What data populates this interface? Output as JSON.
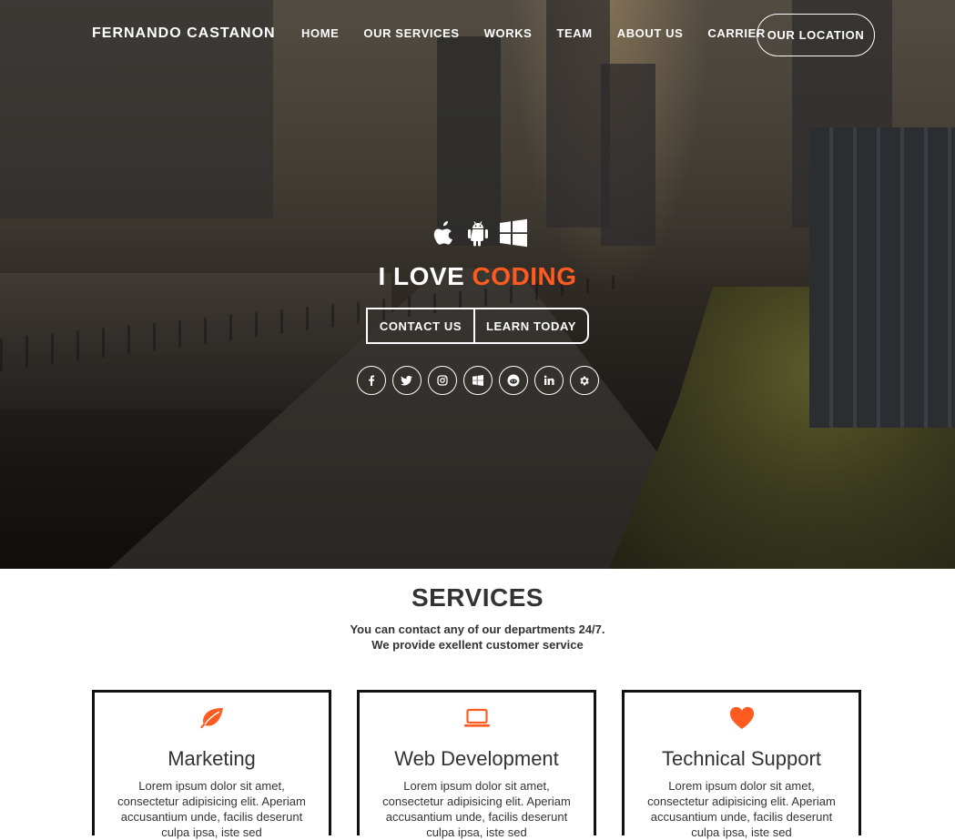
{
  "nav": {
    "brand": "FERNANDO CASTANON",
    "items": [
      "HOME",
      "OUR SERVICES",
      "WORKS",
      "TEAM",
      "ABOUT US",
      "CARRIER"
    ],
    "location_button": "OUR LOCATION"
  },
  "hero": {
    "platform_icons": [
      "apple-icon",
      "android-icon",
      "windows-icon"
    ],
    "headline_prefix": "I LOVE ",
    "headline_accent": "CODING",
    "contact_button": "CONTACT US",
    "learn_button": "LEARN TODAY",
    "social_icons": [
      "facebook-icon",
      "twitter-icon",
      "instagram-icon",
      "windows-icon",
      "reddit-icon",
      "linkedin-icon",
      "settings-icon"
    ]
  },
  "services": {
    "title": "SERVICES",
    "subtitle_line1": "You can contact any of our departments 24/7.",
    "subtitle_line2": "We provide exellent customer service",
    "cards": [
      {
        "icon": "leaf-icon",
        "title": "Marketing",
        "text": "Lorem ipsum dolor sit amet, consectetur adipisicing elit. Aperiam accusantium unde, facilis deserunt culpa ipsa, iste sed"
      },
      {
        "icon": "laptop-icon",
        "title": "Web Development",
        "text": "Lorem ipsum dolor sit amet, consectetur adipisicing elit. Aperiam accusantium unde, facilis deserunt culpa ipsa, iste sed"
      },
      {
        "icon": "heart-icon",
        "title": "Technical Support",
        "text": "Lorem ipsum dolor sit amet, consectetur adipisicing elit. Aperiam accusantium unde, facilis deserunt culpa ipsa, iste sed"
      }
    ]
  },
  "colors": {
    "accent": "#ff5a1f",
    "text": "#333333",
    "border": "#111111"
  }
}
